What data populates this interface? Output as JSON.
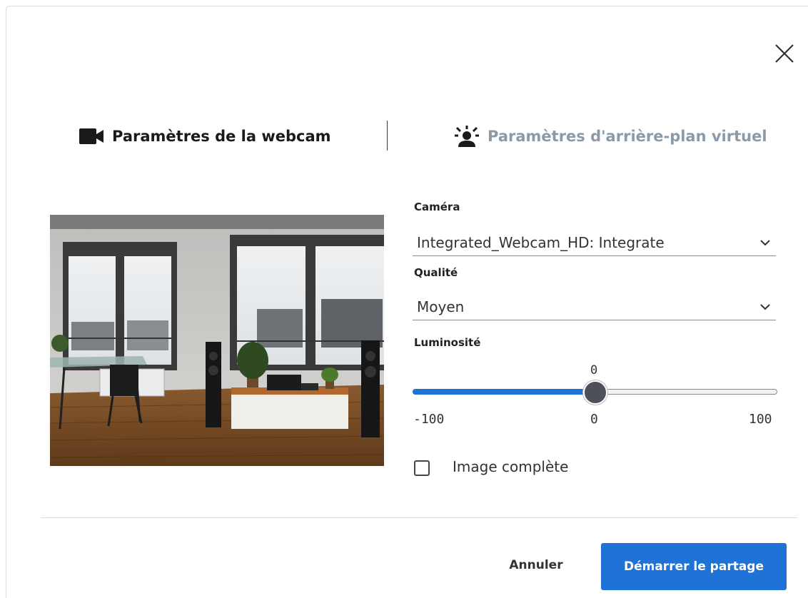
{
  "tabs": {
    "webcam": {
      "label": "Paramètres de la webcam",
      "icon": "video-camera-icon",
      "active": true
    },
    "background": {
      "label": "Paramètres d'arrière-plan virtuel",
      "icon": "virtual-background-icon",
      "active": false
    }
  },
  "camera": {
    "label": "Caméra",
    "value": "Integrated_Webcam_HD: Integrate"
  },
  "quality": {
    "label": "Qualité",
    "value": "Moyen"
  },
  "brightness": {
    "label": "Luminosité",
    "value": "0",
    "min_label": "-100",
    "mid_label": "0",
    "max_label": "100",
    "min": -100,
    "max": 100,
    "current": 0
  },
  "full_image": {
    "label": "Image complète",
    "checked": false
  },
  "footer": {
    "cancel_label": "Annuler",
    "start_label": "Démarrer le partage"
  },
  "colors": {
    "accent": "#1f72d6",
    "inactive_tab": "#8c9aa8"
  }
}
